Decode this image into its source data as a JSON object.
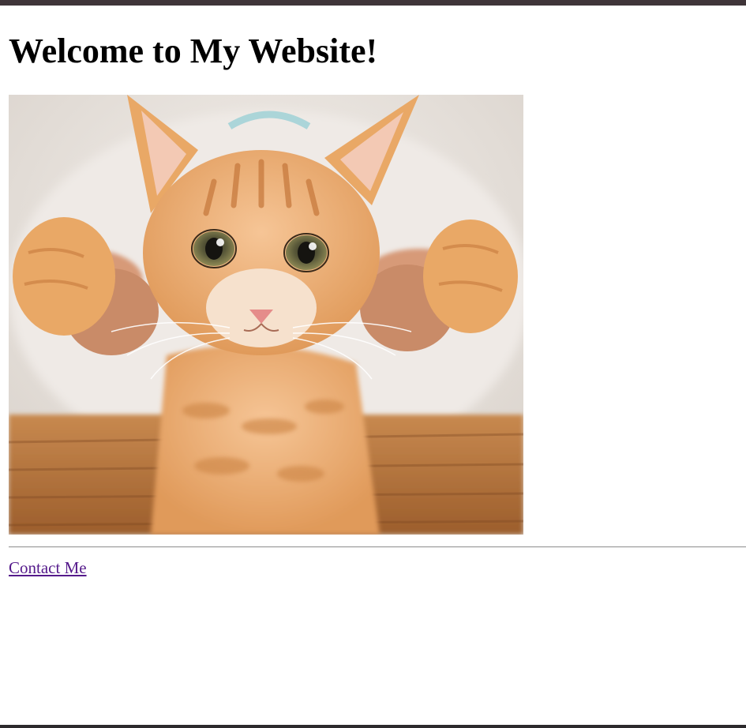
{
  "page": {
    "title": "Welcome to My Website!"
  },
  "hero_image": {
    "icon": "kitten-photo",
    "colors": {
      "fur": "#e9a866",
      "fur_dark": "#c77a3e",
      "background": "#ece7e2",
      "basket": "#b9773f"
    }
  },
  "footer": {
    "contact_link": "Contact Me"
  },
  "colors": {
    "top_bar": "#3f3539",
    "link_visited": "#551a8b",
    "text": "#000000"
  }
}
